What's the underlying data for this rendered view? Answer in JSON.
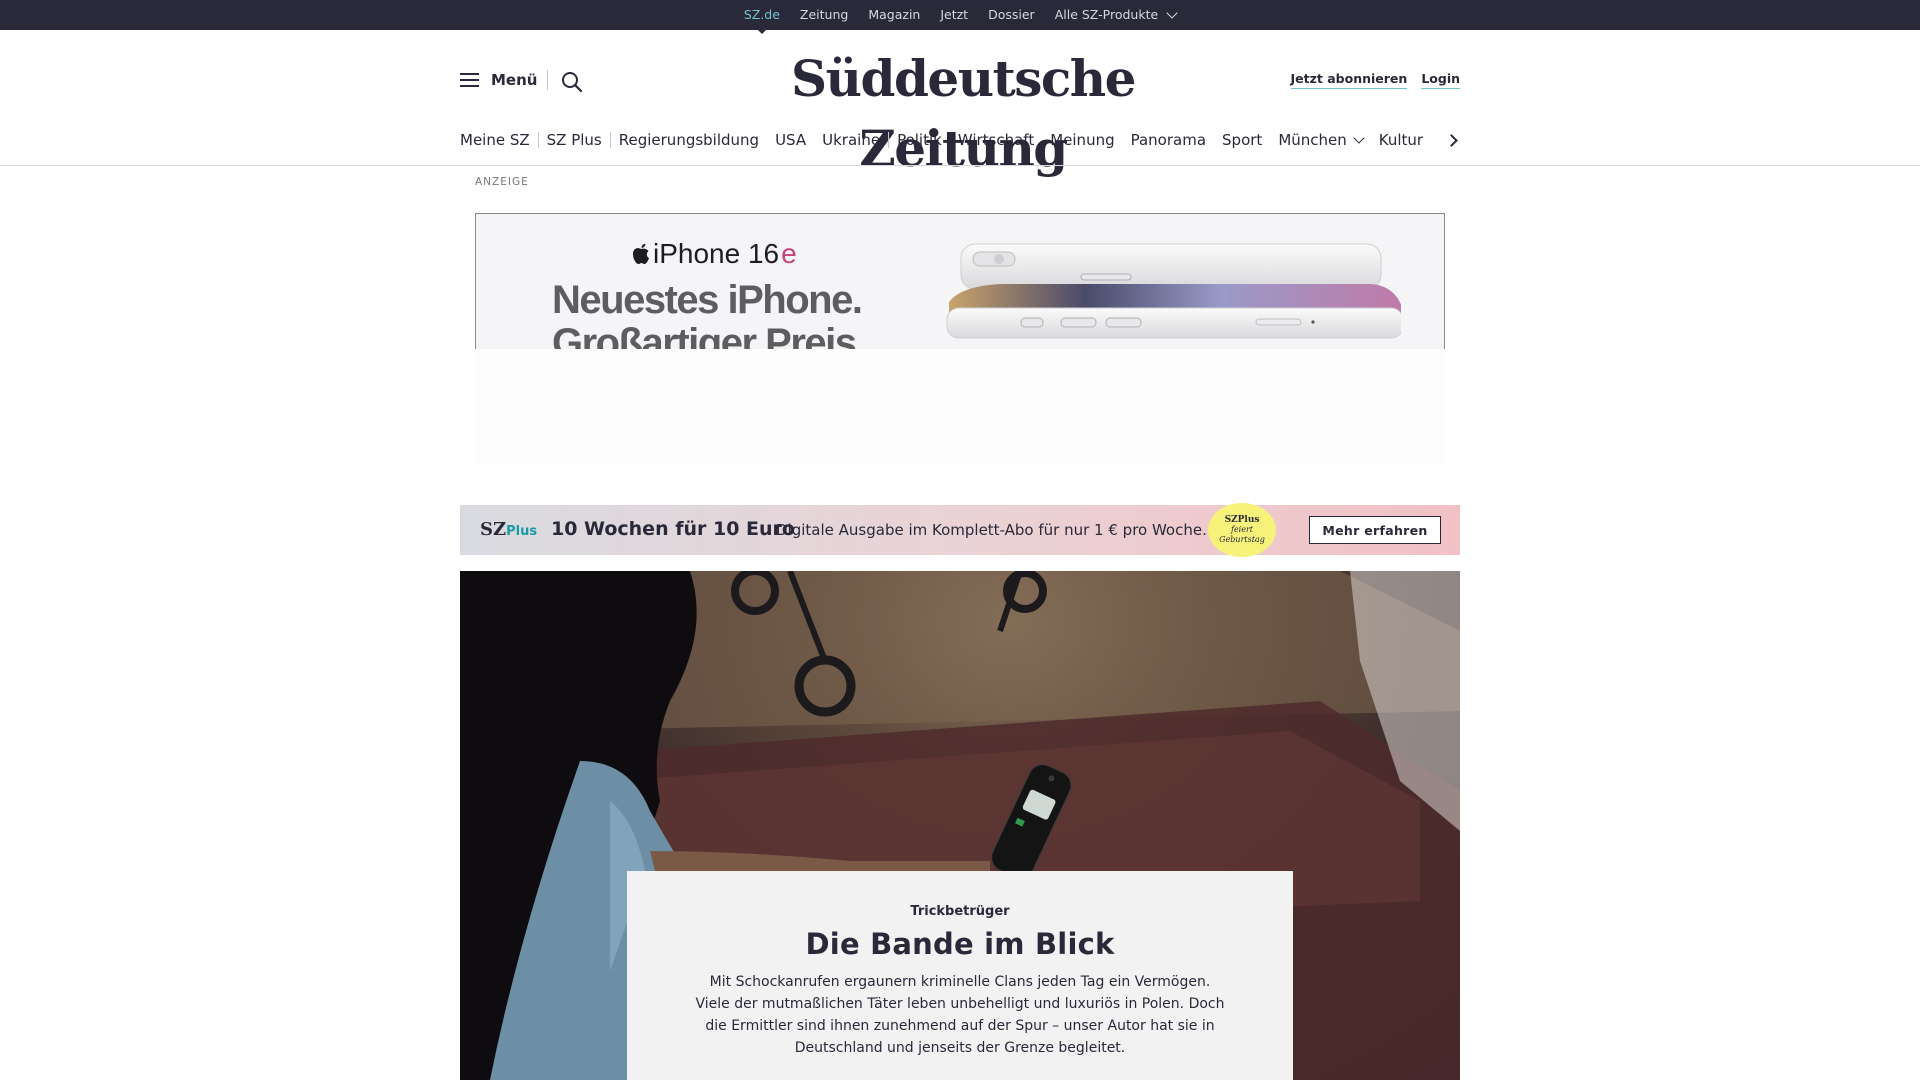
{
  "topbar": {
    "links": [
      "SZ.de",
      "Zeitung",
      "Magazin",
      "Jetzt",
      "Dossier",
      "Alle SZ-Produkte"
    ]
  },
  "header": {
    "menu_label": "Menü",
    "logo": "Süddeutsche Zeitung",
    "subscribe": "Jetzt abonnieren",
    "login": "Login"
  },
  "nav": {
    "items": [
      "Meine SZ",
      "SZ Plus",
      "Regierungsbildung",
      "USA",
      "Ukraine",
      "Politik",
      "Wirtschaft",
      "Meinung",
      "Panorama",
      "Sport",
      "München",
      "Kultur"
    ]
  },
  "ad": {
    "label": "ANZEIGE",
    "brand": "iPhone 16",
    "brand_suffix": "e",
    "headline_1": "Neuestes iPhone.",
    "headline_2": "Großartiger Preis."
  },
  "promo": {
    "logo": "SZ",
    "logo_plus": "Plus",
    "title": "10 Wochen für 10 Euro",
    "text": "Digitale Ausgabe im Komplett-Abo für nur 1 € pro Woche.",
    "badge_1": "SZPlus",
    "badge_2": "feiert",
    "badge_3": "Geburtstag",
    "button": "Mehr erfahren"
  },
  "teaser": {
    "kicker": "Trickbetrüger",
    "headline": "Die Bande im Blick",
    "lead": "Mit Schockanrufen ergaunern kriminelle Clans jeden Tag ein Vermögen. Viele der mutmaßlichen Täter leben unbehelligt und luxuriös in Polen.  Doch die Ermittler sind ihnen zunehmend auf der Spur – unser Autor hat sie in Deutschland und jenseits der Grenze begleitet."
  },
  "colors": {
    "topbar_bg": "#29293a",
    "accent": "#71c3c9",
    "text": "#29293a"
  }
}
